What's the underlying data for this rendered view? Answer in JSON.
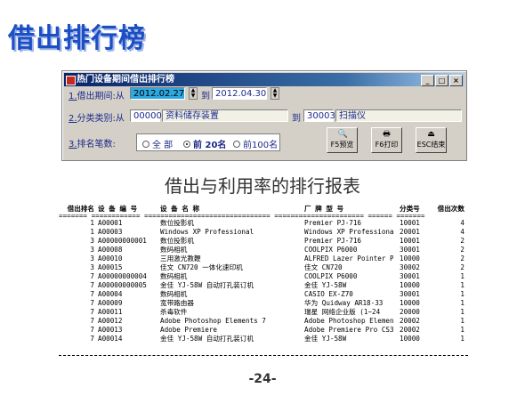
{
  "slide": {
    "title": "借出排行榜",
    "page_number": "-24-"
  },
  "window": {
    "title": "热门设备期间借出排行榜",
    "controls": {
      "minimize": "_",
      "maximize": "□",
      "close": "×"
    },
    "period": {
      "number": "1.",
      "label": "借出期间:从",
      "from": "2012.02.27",
      "to_label": "到",
      "to": "2012.04.30"
    },
    "category": {
      "number": "2.",
      "label": "分类类别:从",
      "from_code": "00000",
      "from_name": "资料储存装置",
      "to_label": "到",
      "to_code": "30003",
      "to_name": "扫描仪"
    },
    "rank_count": {
      "number": "3.",
      "label": "排名笔数:",
      "options": [
        "全 部",
        "前 20名",
        "前100名"
      ],
      "selected": "前 20名"
    },
    "buttons": {
      "preview": "F5预览",
      "print": "F6打印",
      "exit": "ESC结束"
    }
  },
  "report": {
    "title": "借出与利用率的排行报表",
    "headers": {
      "rank": "借出排名",
      "code": "设 备 编 号",
      "name": "设 备 名 称",
      "maker": "厂 牌 型 号",
      "cat": "分类号",
      "count": "借出次数"
    },
    "separator": "======= ============ =============================== ====================== ====== =======",
    "rows": [
      {
        "rank": "1",
        "code": "A00001",
        "name": "数位投影机",
        "maker": "Premier PJ-716",
        "cat": "10001",
        "count": "4"
      },
      {
        "rank": "1",
        "code": "A00003",
        "name": "Windows XP Professional",
        "maker": "Windows XP Professiona",
        "cat": "20001",
        "count": "4"
      },
      {
        "rank": "3",
        "code": "A00000000001",
        "name": "数位投影机",
        "maker": "Premier PJ-716",
        "cat": "10001",
        "count": "2"
      },
      {
        "rank": "3",
        "code": "A00008",
        "name": "数码相机",
        "maker": "COOLPIX P6000",
        "cat": "30001",
        "count": "2"
      },
      {
        "rank": "3",
        "code": "A00010",
        "name": "三用激光教鞭",
        "maker": "ALFRED Lazer Pointer P",
        "cat": "10000",
        "count": "2"
      },
      {
        "rank": "3",
        "code": "A00015",
        "name": "佳文 CN720 一体化速印机",
        "maker": "佳文 CN720",
        "cat": "30002",
        "count": "2"
      },
      {
        "rank": "7",
        "code": "A00000000004",
        "name": "数码相机",
        "maker": "COOLPIX P6000",
        "cat": "30001",
        "count": "1"
      },
      {
        "rank": "7",
        "code": "A00000000005",
        "name": "金佳 YJ-58W 自动打孔装订机",
        "maker": "金佳 YJ-58W",
        "cat": "10000",
        "count": "1"
      },
      {
        "rank": "7",
        "code": "A00004",
        "name": "数码相机",
        "maker": "CASIO EX-Z70",
        "cat": "30001",
        "count": "1"
      },
      {
        "rank": "7",
        "code": "A00009",
        "name": "宽带路由器",
        "maker": "华为 Quidway AR18-33",
        "cat": "10000",
        "count": "1"
      },
      {
        "rank": "7",
        "code": "A00011",
        "name": "杀毒软件",
        "maker": "瑞星 网络企业版 (1~24",
        "cat": "20000",
        "count": "1"
      },
      {
        "rank": "7",
        "code": "A00012",
        "name": "Adobe Photoshop Elements 7",
        "maker": "Adobe Photoshop Elemen",
        "cat": "20002",
        "count": "1"
      },
      {
        "rank": "7",
        "code": "A00013",
        "name": "Adobe Premiere",
        "maker": "Adobe Premiere Pro CS3",
        "cat": "20002",
        "count": "1"
      },
      {
        "rank": "7",
        "code": "A00014",
        "name": "金佳 YJ-58W 自动打孔装订机",
        "maker": "金佳 YJ-58W",
        "cat": "10000",
        "count": "1"
      }
    ]
  },
  "colors": {
    "title_blue": "#1c4fc4",
    "titlebar": "#0a246a",
    "selected_field": "#2ca9e1"
  }
}
